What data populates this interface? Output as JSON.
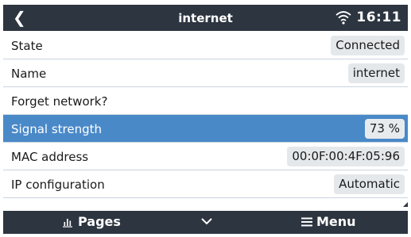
{
  "header": {
    "title": "internet",
    "time": "16:11",
    "back_icon": "chevron-left-icon",
    "wifi_icon": "wifi-icon"
  },
  "rows": [
    {
      "label": "State",
      "value": "Connected"
    },
    {
      "label": "Name",
      "value": "internet"
    },
    {
      "label": "Forget network?",
      "value": ""
    },
    {
      "label": "Signal strength",
      "value": "73 %"
    },
    {
      "label": "MAC address",
      "value": "00:0F:00:4F:05:96"
    },
    {
      "label": "IP configuration",
      "value": "Automatic"
    }
  ],
  "selected_row": "Signal strength",
  "footer": {
    "pages_label": "Pages",
    "pages_icon": "bar-chart-icon",
    "center_icon": "chevron-down-icon",
    "menu_label": "Menu",
    "menu_icon": "hamburger-icon"
  },
  "colors": {
    "bar_bg": "#2d3540",
    "selected_bg": "#4a89c8",
    "value_bg": "#e5e8eb"
  }
}
